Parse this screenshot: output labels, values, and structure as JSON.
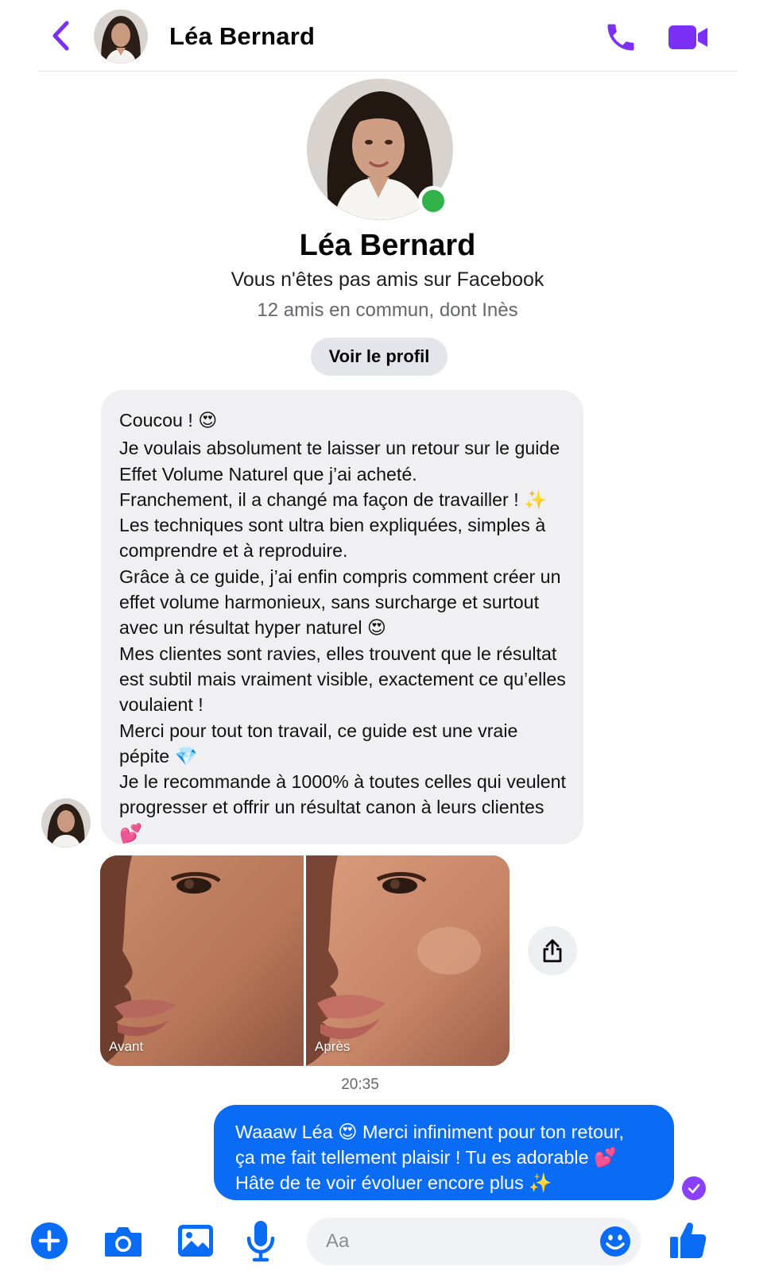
{
  "header": {
    "contact_name": "Léa Bernard"
  },
  "profile": {
    "name": "Léa Bernard",
    "relation": "Vous n'êtes pas amis sur Facebook",
    "mutual": "12 amis en commun, dont Inès",
    "view_profile_label": "Voir le profil"
  },
  "incoming_message": {
    "lines": [
      "Coucou ! 😍",
      "Je voulais absolument te laisser un retour sur le guide Effet Volume Naturel que j’ai acheté.",
      "Franchement, il a changé ma façon de travailler ! ✨",
      "Les techniques sont ultra bien expliquées, simples à comprendre et à reproduire.",
      "Grâce à ce guide, j’ai enfin compris comment créer un effet volume harmonieux, sans surcharge et surtout avec un résultat hyper naturel 😍",
      "Mes clientes sont ravies, elles trouvent que le résultat est subtil mais vraiment visible, exactement ce qu’elles voulaient !",
      "Merci pour tout ton travail, ce guide est une vraie pépite 💎",
      "Je le recommande à 1000% à toutes celles qui veulent progresser et offrir un résultat canon à leurs clientes 💕"
    ]
  },
  "photos": {
    "before_label": "Avant",
    "after_label": "Après"
  },
  "timestamp": "20:35",
  "outgoing_message": {
    "lines": [
      "Waaaw Léa 😍 Merci infiniment pour ton retour,",
      "ça me fait tellement plaisir ! Tu es adorable 💕",
      "Hâte de te voir évoluer encore plus ✨"
    ]
  },
  "composer": {
    "placeholder": "Aa"
  },
  "icons": {
    "back": "chevron-left-icon",
    "call": "phone-icon",
    "video": "video-camera-icon",
    "share": "share-icon",
    "add": "plus-circle-icon",
    "camera": "camera-icon",
    "gallery": "image-icon",
    "mic": "microphone-icon",
    "emoji": "smiley-icon",
    "like": "thumbs-up-icon",
    "seen": "check-circle-icon"
  },
  "colors": {
    "accent_purple": "#7b2ff7",
    "composer_blue": "#0a6cf5",
    "outgoing_bubble": "#0a6cf5",
    "incoming_bubble": "#f0f0f2",
    "online": "#31b34a"
  }
}
